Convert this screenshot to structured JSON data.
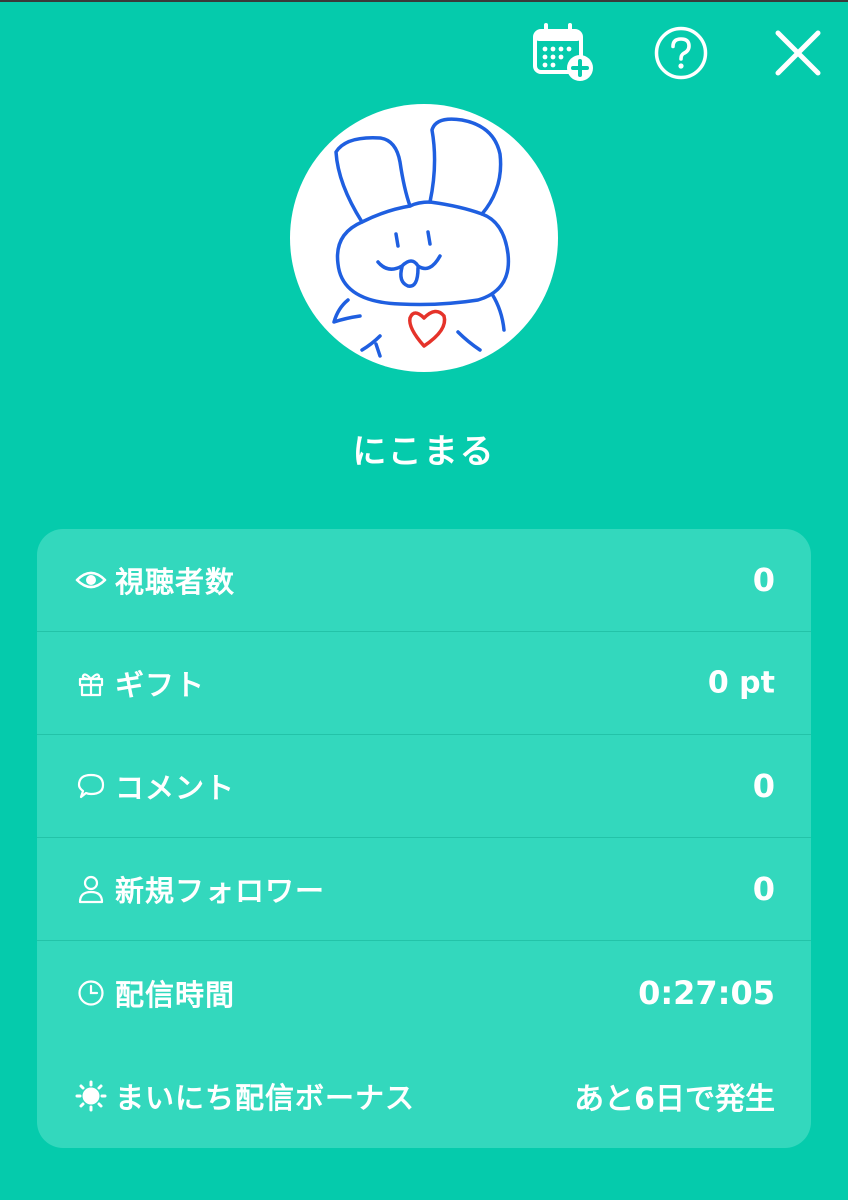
{
  "header": {
    "buttons": [
      {
        "icon": "calendar-add-icon"
      },
      {
        "icon": "help-icon"
      },
      {
        "icon": "close-icon"
      }
    ]
  },
  "profile": {
    "avatar_icon": "rabbit-drawing-avatar",
    "username": "にこまる"
  },
  "stats": {
    "rows": [
      {
        "icon": "eye-icon",
        "label": "視聴者数",
        "value": "0"
      },
      {
        "icon": "gift-icon",
        "label": "ギフト",
        "value": "0 pt"
      },
      {
        "icon": "comment-icon",
        "label": "コメント",
        "value": "0"
      },
      {
        "icon": "person-icon",
        "label": "新規フォロワー",
        "value": "0"
      },
      {
        "icon": "clock-icon",
        "label": "配信時間",
        "value": "0:27:05"
      },
      {
        "icon": "sun-icon",
        "label": "まいにち配信ボーナス",
        "value": "あと6日で発生"
      }
    ]
  },
  "colors": {
    "background": "#05cbac",
    "card": "#33d8bd",
    "divider": "#23c3a8",
    "text": "#ffffff",
    "avatar_line": "#1f5fe0",
    "avatar_heart": "#e5332a"
  }
}
